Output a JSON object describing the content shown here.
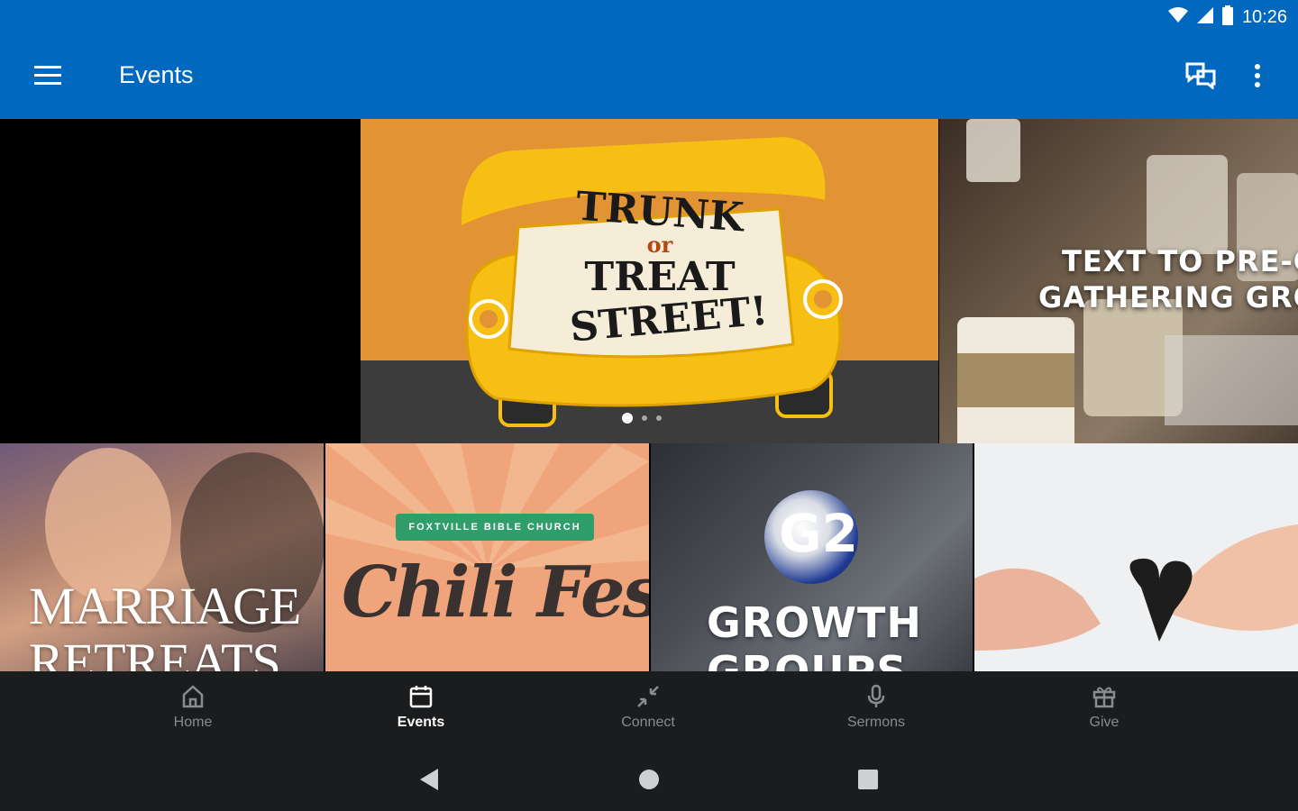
{
  "status_bar": {
    "time": "10:26",
    "icons": [
      "wifi-icon",
      "signal-icon",
      "battery-icon"
    ]
  },
  "app_bar": {
    "title": "Events",
    "icons": [
      "menu-icon",
      "chat-icon",
      "more-vert-icon"
    ]
  },
  "carousel": {
    "slides": [
      {
        "title_lines": [
          "TRUNK",
          "or",
          "TREAT",
          "STREET!"
        ]
      },
      {
        "title_lines": [
          "TEXT TO PRE-C",
          "GATHERING GRO"
        ]
      }
    ],
    "dot_count": 3,
    "active_dot": 0
  },
  "tiles": [
    {
      "title_lines": [
        "MARRIAGE",
        "RETREATS"
      ]
    },
    {
      "subtitle": "FOXTVILLE BIBLE CHURCH",
      "title": "Chili Fest"
    },
    {
      "logo": "G2",
      "title_lines": [
        "GROWTH",
        "GROUPS"
      ]
    },
    {
      "title": ""
    }
  ],
  "bottom_nav": {
    "items": [
      {
        "label": "Home",
        "icon": "home-icon",
        "active": false
      },
      {
        "label": "Events",
        "icon": "calendar-icon",
        "active": true
      },
      {
        "label": "Connect",
        "icon": "connect-icon",
        "active": false
      },
      {
        "label": "Sermons",
        "icon": "microphone-icon",
        "active": false
      },
      {
        "label": "Give",
        "icon": "gift-icon",
        "active": false
      }
    ]
  },
  "colors": {
    "primary": "#0069bf",
    "nav_background": "#1b1c1e",
    "trunk_orange": "#e29334",
    "car_yellow": "#f7be14"
  }
}
